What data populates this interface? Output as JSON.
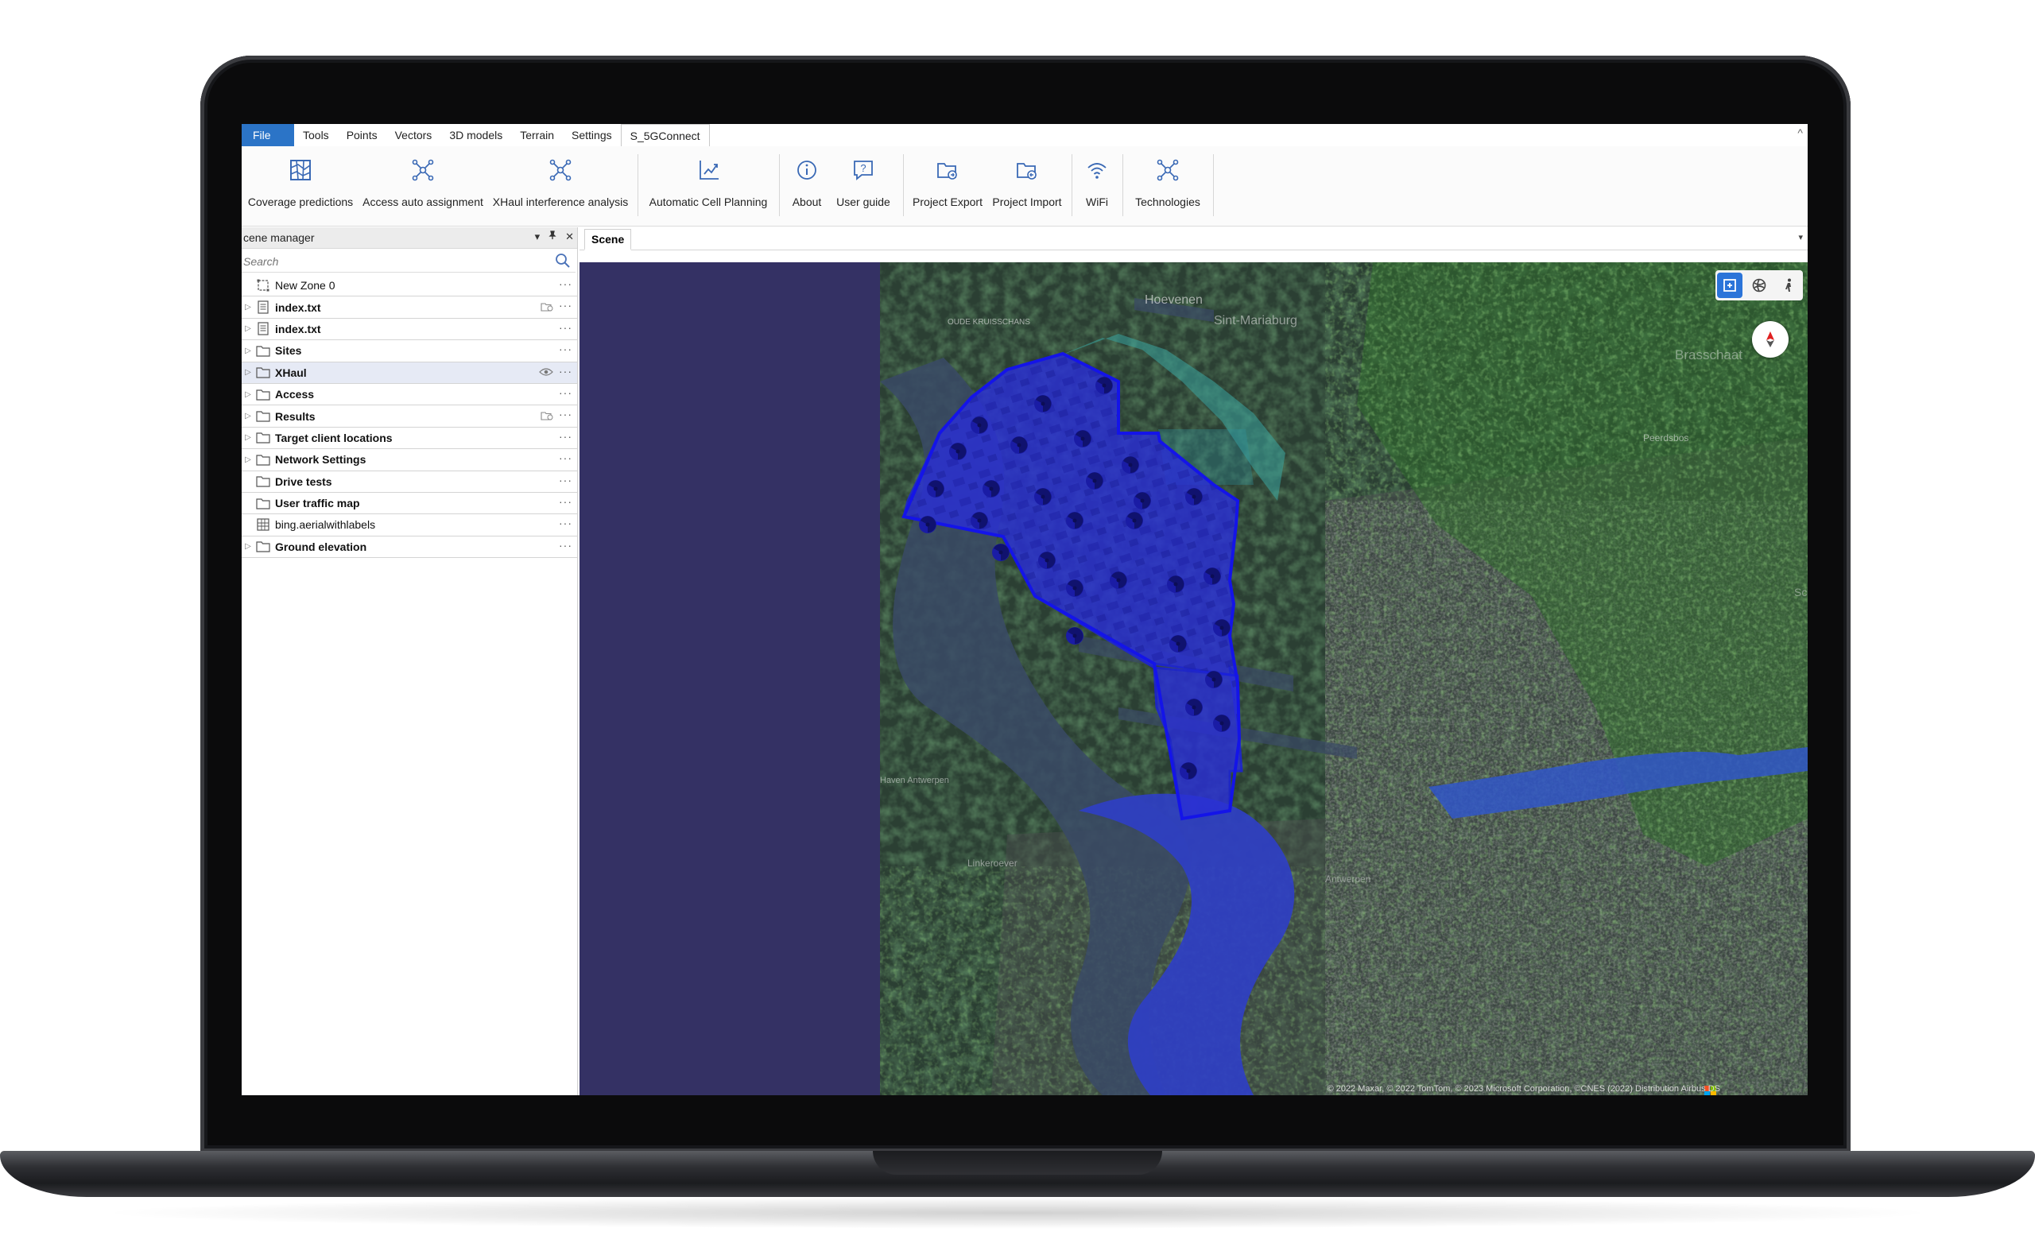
{
  "menu": {
    "items": [
      "File",
      "Tools",
      "Points",
      "Vectors",
      "3D models",
      "Terrain",
      "Settings",
      "S_5GConnect"
    ],
    "collapse_glyph": "^"
  },
  "ribbon": {
    "buttons": [
      {
        "label": "Coverage predictions",
        "icon": "coverage-map-icon"
      },
      {
        "label": "Access auto assignment",
        "icon": "network-nodes-icon"
      },
      {
        "label": "XHaul interference analysis",
        "icon": "network-nodes-icon"
      },
      {
        "label": "Automatic Cell Planning",
        "icon": "chart-axes-icon"
      },
      {
        "label": "About",
        "icon": "info-icon"
      },
      {
        "label": "User guide",
        "icon": "help-icon"
      },
      {
        "label": "Project Export",
        "icon": "folder-export-icon"
      },
      {
        "label": "Project Import",
        "icon": "folder-import-icon"
      },
      {
        "label": "WiFi",
        "icon": "wifi-icon"
      },
      {
        "label": "Technologies",
        "icon": "network-nodes-icon"
      }
    ]
  },
  "scene_manager": {
    "title": "cene manager",
    "tools": [
      "▾",
      "✎",
      "✕"
    ],
    "search_placeholder": "Search",
    "items": [
      {
        "label": "New Zone 0",
        "bold": false,
        "icon": "zone-icon",
        "expandable": false
      },
      {
        "label": "index.txt",
        "bold": true,
        "icon": "document-icon",
        "expandable": true,
        "extra": "layers-icon"
      },
      {
        "label": "index.txt",
        "bold": true,
        "icon": "document-icon",
        "expandable": true
      },
      {
        "label": "Sites",
        "bold": true,
        "icon": "folder-icon",
        "expandable": true
      },
      {
        "label": "XHaul",
        "bold": true,
        "icon": "folder-icon",
        "expandable": true,
        "extra": "eye-icon",
        "selected": true
      },
      {
        "label": "Access",
        "bold": true,
        "icon": "folder-icon",
        "expandable": true
      },
      {
        "label": "Results",
        "bold": true,
        "icon": "folder-icon",
        "expandable": true,
        "extra": "layers-icon"
      },
      {
        "label": "Target client locations",
        "bold": true,
        "icon": "folder-icon",
        "expandable": true
      },
      {
        "label": "Network Settings",
        "bold": true,
        "icon": "folder-icon",
        "expandable": true
      },
      {
        "label": "Drive tests",
        "bold": true,
        "icon": "folder-icon",
        "expandable": false
      },
      {
        "label": "User traffic map",
        "bold": true,
        "icon": "folder-icon",
        "expandable": false
      },
      {
        "label": "bing.aerialwithlabels",
        "bold": false,
        "icon": "grid-map-icon",
        "expandable": false
      },
      {
        "label": "Ground elevation",
        "bold": true,
        "icon": "folder-icon",
        "expandable": true
      }
    ],
    "more_glyph": "···"
  },
  "scene": {
    "tab_label": "Scene",
    "dropdown_glyph": "▾",
    "map_labels": [
      "Hoevenen",
      "Sint-Mariaburg",
      "OUDE KRUISSCHANS",
      "Brasschaat",
      "Peerdsbos",
      "Schoten",
      "Linkeroever",
      "Antwerpen",
      "Haven Antwerpen"
    ],
    "attribution": "© 2022 Maxar, © 2022 TomTom, © 2023 Microsoft Corporation, ©CNES (2022) Distribution Airbus DS"
  },
  "colors": {
    "file_menu": "#2b74c7",
    "coverage_fill": "#2a2fd6",
    "viewport_bg": "#343164",
    "map_tool_active": "#2b74d9"
  }
}
